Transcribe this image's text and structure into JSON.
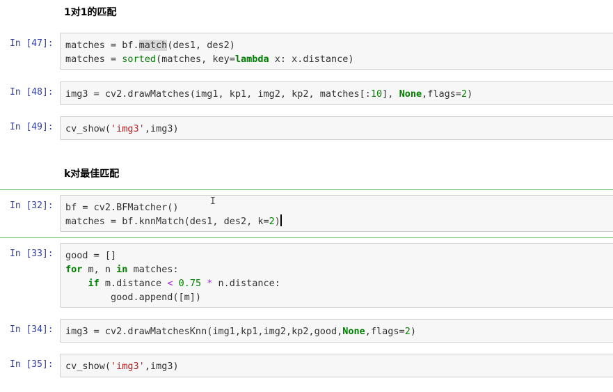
{
  "headings": {
    "one_to_one": "1对1的匹配",
    "knn": "k对最佳匹配"
  },
  "cells": [
    {
      "prompt": "In [47]:",
      "lines": [
        [
          {
            "t": "matches = bf."
          },
          {
            "t": "match",
            "c": "hl"
          },
          {
            "t": "(des1, des2)"
          }
        ],
        [
          {
            "t": "matches = "
          },
          {
            "t": "sorted",
            "c": "n"
          },
          {
            "t": "(matches, key="
          },
          {
            "t": "lambda",
            "c": "k"
          },
          {
            "t": " x: x.distance)"
          }
        ]
      ]
    },
    {
      "prompt": "In [48]:",
      "lines": [
        [
          {
            "t": "img3 = cv2.drawMatches(img1, kp1, img2, kp2, matches[:"
          },
          {
            "t": "10",
            "c": "n"
          },
          {
            "t": "], "
          },
          {
            "t": "None",
            "c": "k"
          },
          {
            "t": ",flags="
          },
          {
            "t": "2",
            "c": "n"
          },
          {
            "t": ")"
          }
        ]
      ]
    },
    {
      "prompt": "In [49]:",
      "lines": [
        [
          {
            "t": "cv_show("
          },
          {
            "t": "'img3'",
            "c": "s"
          },
          {
            "t": ",img3)"
          }
        ]
      ]
    },
    {
      "prompt": "In [32]:",
      "lines": [
        [
          {
            "t": "bf = cv2.BFMatcher()"
          }
        ],
        [
          {
            "t": "matches = bf.knnMatch(des1, des2, k="
          },
          {
            "t": "2",
            "c": "n"
          },
          {
            "t": ")"
          }
        ]
      ]
    },
    {
      "prompt": "In [33]:",
      "lines": [
        [
          {
            "t": "good = []"
          }
        ],
        [
          {
            "t": "for",
            "c": "k"
          },
          {
            "t": " m, n "
          },
          {
            "t": "in",
            "c": "k"
          },
          {
            "t": " matches:"
          }
        ],
        [
          {
            "t": "    "
          },
          {
            "t": "if",
            "c": "k"
          },
          {
            "t": " m.distance "
          },
          {
            "t": "<",
            "c": "o"
          },
          {
            "t": " "
          },
          {
            "t": "0.75",
            "c": "n"
          },
          {
            "t": " "
          },
          {
            "t": "*",
            "c": "o"
          },
          {
            "t": " n.distance:"
          }
        ],
        [
          {
            "t": "        good.append([m])"
          }
        ]
      ]
    },
    {
      "prompt": "In [34]:",
      "lines": [
        [
          {
            "t": "img3 = cv2.drawMatchesKnn(img1,kp1,img2,kp2,good,"
          },
          {
            "t": "None",
            "c": "k"
          },
          {
            "t": ",flags="
          },
          {
            "t": "2",
            "c": "n"
          },
          {
            "t": ")"
          }
        ]
      ]
    },
    {
      "prompt": "In [35]:",
      "lines": [
        [
          {
            "t": "cv_show("
          },
          {
            "t": "'img3'",
            "c": "s"
          },
          {
            "t": ",img3)"
          }
        ]
      ]
    }
  ]
}
